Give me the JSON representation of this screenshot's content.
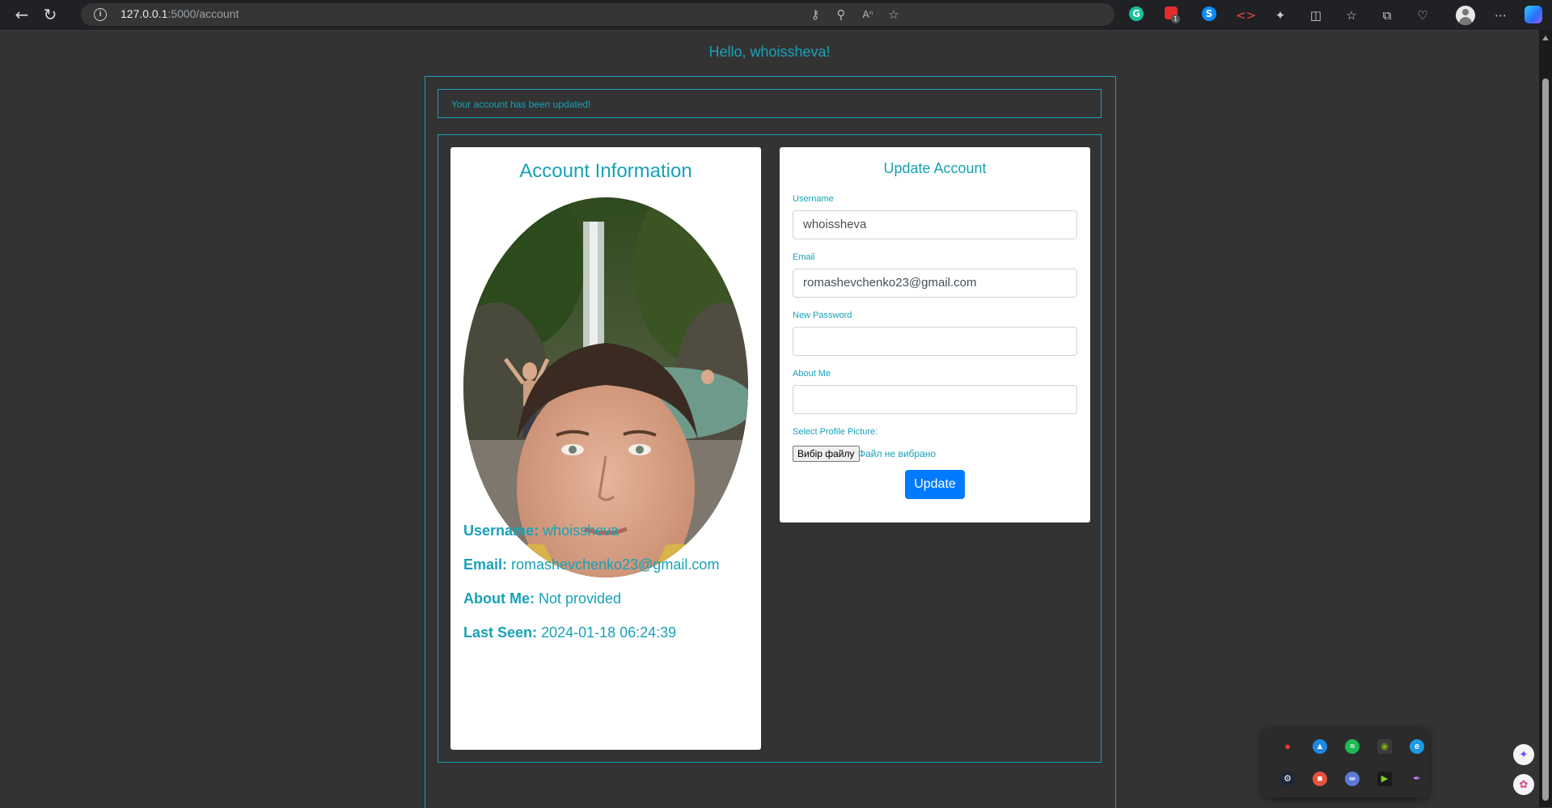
{
  "browser": {
    "url_host": "127.0.0.1",
    "url_path": ":5000/account",
    "extension_badge": "1"
  },
  "page": {
    "greeting": "Hello, whoissheva!",
    "alert": "Your account has been updated!"
  },
  "account_info": {
    "title": "Account Information",
    "username_label": "Username:",
    "username": "whoissheva",
    "email_label": "Email:",
    "email": "romashevchenko23@gmail.com",
    "about_label": "About Me:",
    "about": "Not provided",
    "last_seen_label": "Last Seen:",
    "last_seen": "2024-01-18 06:24:39"
  },
  "update_form": {
    "title": "Update Account",
    "username_label": "Username",
    "username_value": "whoissheva",
    "email_label": "Email",
    "email_value": "romashevchenko23@gmail.com",
    "password_label": "New Password",
    "password_value": "",
    "about_label": "About Me",
    "about_value": "",
    "picture_label": "Select Profile Picture:",
    "file_button": "Вибір файлу",
    "file_status": "Файл не вибрано",
    "submit": "Update"
  },
  "colors": {
    "accent": "#17a2b8",
    "primary_button": "#007bff",
    "page_bg": "#333333"
  },
  "icons": {
    "toolbar": [
      "back-icon",
      "reload-icon",
      "site-info-icon",
      "key-icon",
      "zoom-out-icon",
      "read-aloud-icon",
      "favorite-icon",
      "grammarly-icon",
      "adblock-icon",
      "shazam-icon",
      "devtools-icon",
      "extensions-icon",
      "split-screen-icon",
      "favorites-icon",
      "collections-icon",
      "browser-essentials-icon",
      "profile-icon",
      "more-icon",
      "copilot-icon"
    ],
    "tray": [
      "voice-icon",
      "drive-icon",
      "spotify-icon",
      "nvidia-icon",
      "edge-icon",
      "steam-icon",
      "app-icon",
      "chat-icon",
      "media-player-icon",
      "pen-icon"
    ]
  }
}
